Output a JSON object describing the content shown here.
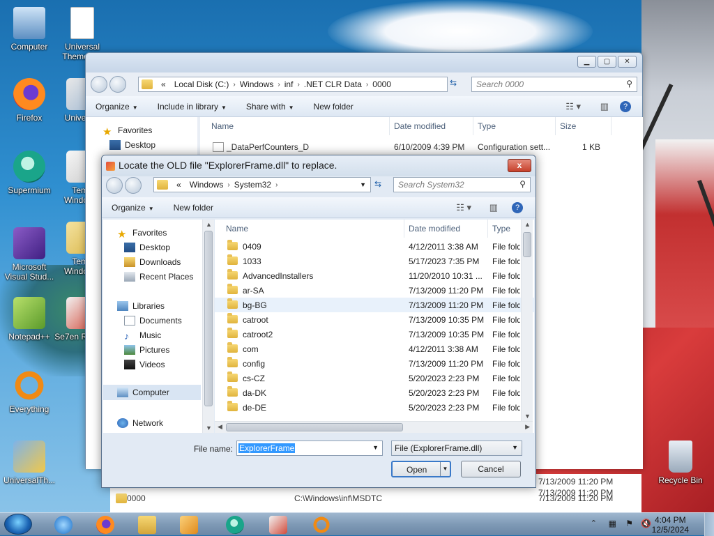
{
  "desktop": {
    "icons": [
      {
        "label": "Computer",
        "icon": "computer-icon"
      },
      {
        "label": "Universal Theme P...",
        "icon": "document-icon"
      },
      {
        "label": "Firefox",
        "icon": "firefox-icon"
      },
      {
        "label": "Univers...",
        "icon": "theme-icon"
      },
      {
        "label": "Supermium",
        "icon": "supermium-icon"
      },
      {
        "label": "Tema Window...",
        "icon": "theme-icon"
      },
      {
        "label": "Microsoft Visual Stud...",
        "icon": "visual-studio-icon"
      },
      {
        "label": "Tema Window...",
        "icon": "theme-icon"
      },
      {
        "label": "Notepad++",
        "icon": "notepadpp-icon"
      },
      {
        "label": "Se7en Repla...",
        "icon": "replacer-icon"
      },
      {
        "label": "Everything",
        "icon": "everything-icon"
      },
      {
        "label": "UniversalTh...",
        "icon": "universal-theme-icon"
      },
      {
        "label": "Recycle Bin",
        "icon": "recycle-bin-icon"
      }
    ]
  },
  "explorer": {
    "address": [
      "«",
      "Local Disk (C:)",
      "Windows",
      "inf",
      ".NET CLR Data",
      "0000"
    ],
    "search_placeholder": "Search 0000",
    "toolbar": {
      "organize": "Organize",
      "include": "Include in library",
      "share": "Share with",
      "new_folder": "New folder"
    },
    "nav": {
      "favorites": "Favorites",
      "desktop": "Desktop"
    },
    "columns": {
      "name": "Name",
      "date": "Date modified",
      "type": "Type",
      "size": "Size"
    },
    "file": {
      "name": "_DataPerfCounters_D",
      "date": "6/10/2009 4:39 PM",
      "type": "Configuration sett...",
      "size": "1 KB"
    }
  },
  "behind_list": {
    "dates": [
      "7/13/2009 11:20 PM",
      "7/13/2009 11:20 PM",
      "7/13/2009 11:20 PM"
    ],
    "row_name": "0000",
    "row_path": "C:\\Windows\\inf\\MSDTC"
  },
  "dialog": {
    "title": "Locate the OLD file \"ExplorerFrame.dll\" to replace.",
    "close": "x",
    "address": [
      "«",
      "Windows",
      "System32"
    ],
    "search_placeholder": "Search System32",
    "toolbar": {
      "organize": "Organize",
      "new_folder": "New folder"
    },
    "nav": {
      "favorites": "Favorites",
      "desktop": "Desktop",
      "downloads": "Downloads",
      "recent": "Recent Places",
      "libraries": "Libraries",
      "documents": "Documents",
      "music": "Music",
      "pictures": "Pictures",
      "videos": "Videos",
      "computer": "Computer",
      "network": "Network"
    },
    "columns": {
      "name": "Name",
      "date": "Date modified",
      "type": "Type"
    },
    "files": [
      {
        "name": "0409",
        "date": "4/12/2011 3:38 AM",
        "type": "File fold"
      },
      {
        "name": "1033",
        "date": "5/17/2023 7:35 PM",
        "type": "File fold"
      },
      {
        "name": "AdvancedInstallers",
        "date": "11/20/2010 10:31 ...",
        "type": "File fold"
      },
      {
        "name": "ar-SA",
        "date": "7/13/2009 11:20 PM",
        "type": "File fold"
      },
      {
        "name": "bg-BG",
        "date": "7/13/2009 11:20 PM",
        "type": "File fold"
      },
      {
        "name": "catroot",
        "date": "7/13/2009 10:35 PM",
        "type": "File fold"
      },
      {
        "name": "catroot2",
        "date": "7/13/2009 10:35 PM",
        "type": "File fold"
      },
      {
        "name": "com",
        "date": "4/12/2011 3:38 AM",
        "type": "File fold"
      },
      {
        "name": "config",
        "date": "7/13/2009 11:20 PM",
        "type": "File fold"
      },
      {
        "name": "cs-CZ",
        "date": "5/20/2023 2:23 PM",
        "type": "File fold"
      },
      {
        "name": "da-DK",
        "date": "5/20/2023 2:23 PM",
        "type": "File fold"
      },
      {
        "name": "de-DE",
        "date": "5/20/2023 2:23 PM",
        "type": "File fold"
      }
    ],
    "filename_label": "File name:",
    "filename_value": "ExplorerFrame",
    "filetype_value": "File (ExplorerFrame.dll)",
    "open": "Open",
    "cancel": "Cancel"
  },
  "taskbar": {
    "time": "4:04 PM",
    "date": "12/5/2024",
    "apps": [
      "internet-explorer-icon",
      "firefox-icon",
      "explorer-icon",
      "media-player-icon",
      "supermium-icon",
      "replacer-icon",
      "everything-icon"
    ]
  }
}
